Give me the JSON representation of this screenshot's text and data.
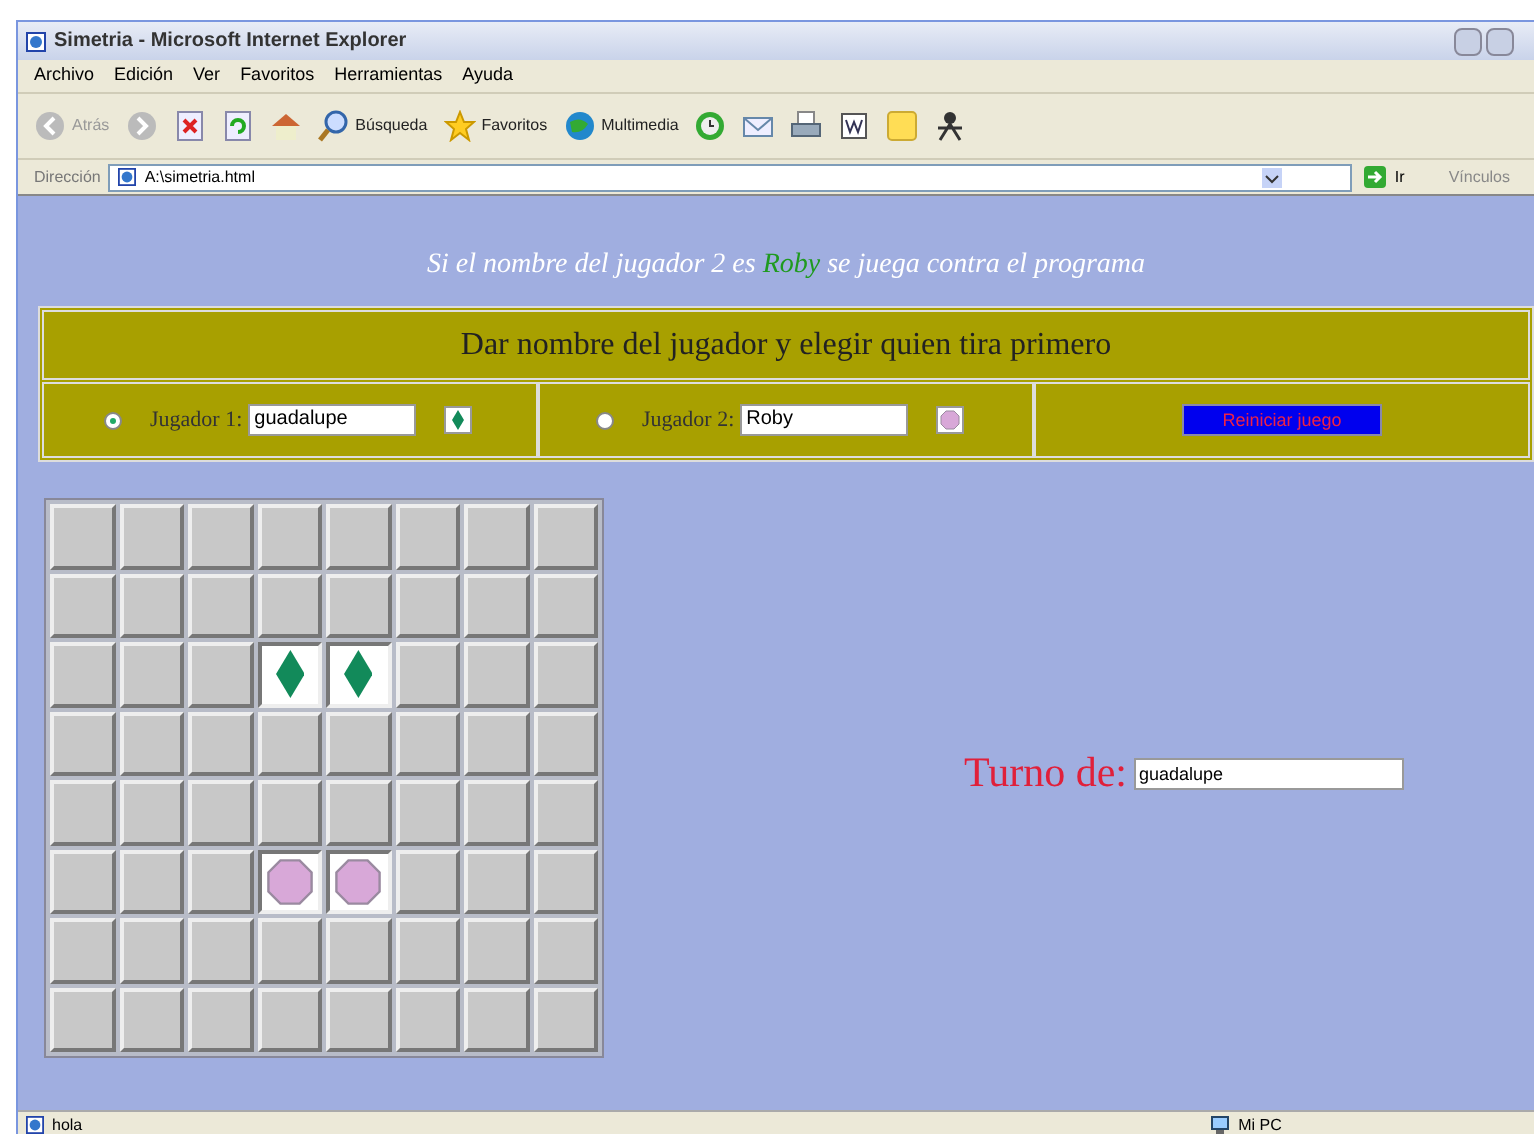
{
  "window": {
    "title": "Simetria - Microsoft Internet Explorer"
  },
  "menu": [
    "Archivo",
    "Edición",
    "Ver",
    "Favoritos",
    "Herramientas",
    "Ayuda"
  ],
  "toolbar": [
    {
      "kind": "back",
      "label": "Atrás"
    },
    {
      "kind": "forward"
    },
    {
      "kind": "stop"
    },
    {
      "kind": "refresh"
    },
    {
      "kind": "home"
    },
    {
      "kind": "search",
      "label": "Búsqueda"
    },
    {
      "kind": "favorites",
      "label": "Favoritos"
    },
    {
      "kind": "media",
      "label": "Multimedia"
    },
    {
      "kind": "history"
    },
    {
      "kind": "mail"
    },
    {
      "kind": "print"
    },
    {
      "kind": "edit"
    },
    {
      "kind": "note"
    },
    {
      "kind": "messenger"
    }
  ],
  "address": {
    "label": "Dirección",
    "value": "A:\\simetria.html",
    "go": "Ir",
    "links": "Vínculos"
  },
  "page": {
    "subtitle": {
      "before": "Si el nombre del jugador 2 es",
      "highlight": "Roby",
      "after": "se juega contra el programa"
    },
    "panel_title": "Dar nombre del jugador y elegir quien tira primero",
    "players": [
      {
        "label": "Jugador 1:",
        "name": "guadalupe",
        "selected": true,
        "kind": "diamond"
      },
      {
        "label": "Jugador 2:",
        "name": "Roby",
        "selected": false,
        "kind": "octagon"
      }
    ],
    "reset_button": "Reiniciar juego",
    "board": [
      [
        {
          "kind": "empty"
        },
        {
          "kind": "empty"
        },
        {
          "kind": "empty"
        },
        {
          "kind": "empty"
        },
        {
          "kind": "empty"
        },
        {
          "kind": "empty"
        },
        {
          "kind": "empty"
        },
        {
          "kind": "empty"
        }
      ],
      [
        {
          "kind": "empty"
        },
        {
          "kind": "empty"
        },
        {
          "kind": "empty"
        },
        {
          "kind": "empty"
        },
        {
          "kind": "empty"
        },
        {
          "kind": "empty"
        },
        {
          "kind": "empty"
        },
        {
          "kind": "empty"
        }
      ],
      [
        {
          "kind": "empty"
        },
        {
          "kind": "empty"
        },
        {
          "kind": "empty"
        },
        {
          "kind": "diamond"
        },
        {
          "kind": "diamond"
        },
        {
          "kind": "empty"
        },
        {
          "kind": "empty"
        },
        {
          "kind": "empty"
        }
      ],
      [
        {
          "kind": "empty"
        },
        {
          "kind": "empty"
        },
        {
          "kind": "empty"
        },
        {
          "kind": "empty"
        },
        {
          "kind": "empty"
        },
        {
          "kind": "empty"
        },
        {
          "kind": "empty"
        },
        {
          "kind": "empty"
        }
      ],
      [
        {
          "kind": "empty"
        },
        {
          "kind": "empty"
        },
        {
          "kind": "empty"
        },
        {
          "kind": "empty"
        },
        {
          "kind": "empty"
        },
        {
          "kind": "empty"
        },
        {
          "kind": "empty"
        },
        {
          "kind": "empty"
        }
      ],
      [
        {
          "kind": "empty"
        },
        {
          "kind": "empty"
        },
        {
          "kind": "empty"
        },
        {
          "kind": "octagon"
        },
        {
          "kind": "octagon"
        },
        {
          "kind": "empty"
        },
        {
          "kind": "empty"
        },
        {
          "kind": "empty"
        }
      ],
      [
        {
          "kind": "empty"
        },
        {
          "kind": "empty"
        },
        {
          "kind": "empty"
        },
        {
          "kind": "empty"
        },
        {
          "kind": "empty"
        },
        {
          "kind": "empty"
        },
        {
          "kind": "empty"
        },
        {
          "kind": "empty"
        }
      ],
      [
        {
          "kind": "empty"
        },
        {
          "kind": "empty"
        },
        {
          "kind": "empty"
        },
        {
          "kind": "empty"
        },
        {
          "kind": "empty"
        },
        {
          "kind": "empty"
        },
        {
          "kind": "empty"
        },
        {
          "kind": "empty"
        }
      ]
    ],
    "turn": {
      "label": "Turno de:",
      "value": "guadalupe"
    }
  },
  "status_bar": {
    "text": "hola",
    "zone": "Mi PC"
  }
}
